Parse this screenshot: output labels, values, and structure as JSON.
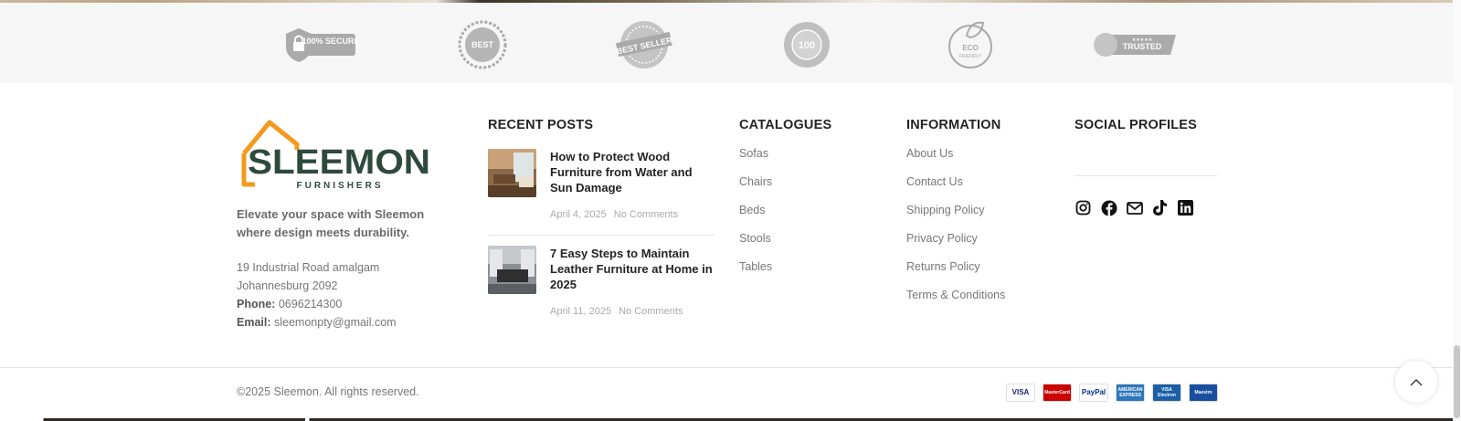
{
  "trust_badges": [
    {
      "icon": "secure-lock-badge-icon",
      "text": "100% SECURE"
    },
    {
      "icon": "best-quality-badge-icon",
      "text": "BEST QUALITY"
    },
    {
      "icon": "best-seller-badge-icon",
      "text": "BEST SELLER"
    },
    {
      "icon": "customer-satisfaction-badge-icon",
      "text": "100"
    },
    {
      "icon": "eco-friendly-badge-icon",
      "text": "ECO FRIENDLY"
    },
    {
      "icon": "trusted-badge-icon",
      "text": "TRUSTED"
    }
  ],
  "brand": {
    "name": "SLEEMON",
    "subname": "FURNISHERS",
    "tagline": "Elevate your space with Sleemon where design meets durability.",
    "address": "19 Industrial Road amalgam Johannesburg 2092",
    "phone_label": "Phone:",
    "phone": "0696214300",
    "email_label": "Email:",
    "email": "sleemonpty@gmail.com",
    "colors": {
      "green": "#2e4a3c",
      "orange": "#f39a1e"
    }
  },
  "recent_posts": {
    "title": "RECENT POSTS",
    "posts": [
      {
        "title": "How to Protect Wood Furniture from Water and Sun Damage",
        "date": "April 4, 2025",
        "comments": "No Comments"
      },
      {
        "title": "7 Easy Steps to Maintain Leather Furniture at Home in 2025",
        "date": "April 11, 2025",
        "comments": "No Comments"
      }
    ]
  },
  "catalogues": {
    "title": "CATALOGUES",
    "items": [
      "Sofas",
      "Chairs",
      "Beds",
      "Stools",
      "Tables"
    ]
  },
  "information": {
    "title": "INFORMATION",
    "items": [
      "About Us",
      "Contact Us",
      "Shipping Policy",
      "Privacy Policy",
      "Returns Policy",
      "Terms & Conditions"
    ]
  },
  "social": {
    "title": "SOCIAL PROFILES",
    "icons": [
      "instagram-icon",
      "facebook-icon",
      "email-icon",
      "tiktok-icon",
      "linkedin-icon"
    ]
  },
  "footer": {
    "copyright": "©2025 Sleemon. All rights reserved.",
    "payments": [
      {
        "label": "VISA",
        "bg": "#ffffff",
        "fg": "#1a1f71"
      },
      {
        "label": "MasterCard",
        "bg": "#cc0000",
        "fg": "#ffffff"
      },
      {
        "label": "PayPal",
        "bg": "#ffffff",
        "fg": "#003087"
      },
      {
        "label": "AMERICAN EXPRESS",
        "bg": "#2e77bc",
        "fg": "#ffffff"
      },
      {
        "label": "VISA Electron",
        "bg": "#1a5fa8",
        "fg": "#ffffff"
      },
      {
        "label": "Maestro",
        "bg": "#1a4fa0",
        "fg": "#ffffff"
      }
    ]
  }
}
